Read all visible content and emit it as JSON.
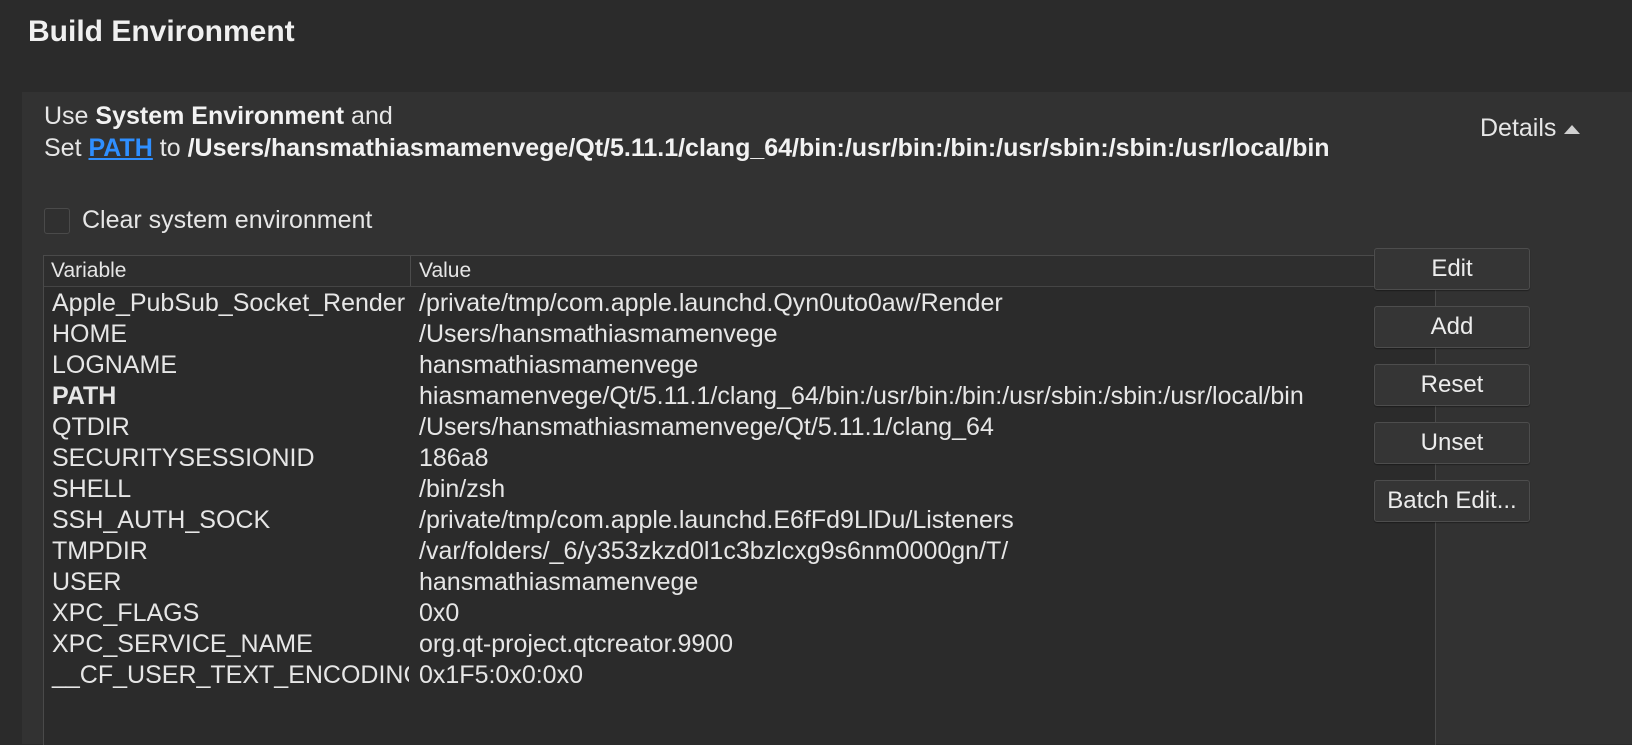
{
  "section": {
    "title": "Build Environment"
  },
  "summary": {
    "line1_prefix": "Use ",
    "line1_bold": "System Environment",
    "line1_suffix": " and",
    "line2_prefix": "Set ",
    "line2_link": "PATH",
    "line2_mid": " to ",
    "line2_value": "/Users/hansmathiasmamenvege/Qt/5.11.1/clang_64/bin:/usr/bin:/bin:/usr/sbin:/sbin:/usr/local/bin"
  },
  "details": {
    "label": "Details",
    "icon": "triangle-up-icon"
  },
  "clear_env": {
    "label": "Clear system environment",
    "checked": false
  },
  "table": {
    "headers": {
      "variable": "Variable",
      "value": "Value"
    },
    "rows": [
      {
        "variable": "Apple_PubSub_Socket_Render",
        "value": "/private/tmp/com.apple.launchd.Qyn0uto0aw/Render"
      },
      {
        "variable": "HOME",
        "value": "/Users/hansmathiasmamenvege"
      },
      {
        "variable": "LOGNAME",
        "value": "hansmathiasmamenvege"
      },
      {
        "variable": "PATH",
        "value": "hiasmamenvege/Qt/5.11.1/clang_64/bin:/usr/bin:/bin:/usr/sbin:/sbin:/usr/local/bin"
      },
      {
        "variable": "QTDIR",
        "value": "/Users/hansmathiasmamenvege/Qt/5.11.1/clang_64"
      },
      {
        "variable": "SECURITYSESSIONID",
        "value": "186a8"
      },
      {
        "variable": "SHELL",
        "value": "/bin/zsh"
      },
      {
        "variable": "SSH_AUTH_SOCK",
        "value": "/private/tmp/com.apple.launchd.E6fFd9LlDu/Listeners"
      },
      {
        "variable": "TMPDIR",
        "value": "/var/folders/_6/y353zkzd0l1c3bzlcxg9s6nm0000gn/T/"
      },
      {
        "variable": "USER",
        "value": "hansmathiasmamenvege"
      },
      {
        "variable": "XPC_FLAGS",
        "value": "0x0"
      },
      {
        "variable": "XPC_SERVICE_NAME",
        "value": "org.qt-project.qtcreator.9900"
      },
      {
        "variable": "__CF_USER_TEXT_ENCODING",
        "value": "0x1F5:0x0:0x0"
      }
    ]
  },
  "buttons": {
    "edit": "Edit",
    "add": "Add",
    "reset": "Reset",
    "unset": "Unset",
    "batch_edit": "Batch Edit..."
  },
  "colors": {
    "background": "#2b2b2b",
    "panel": "#323232",
    "link": "#2f8fff",
    "text": "#e6e6e6"
  }
}
